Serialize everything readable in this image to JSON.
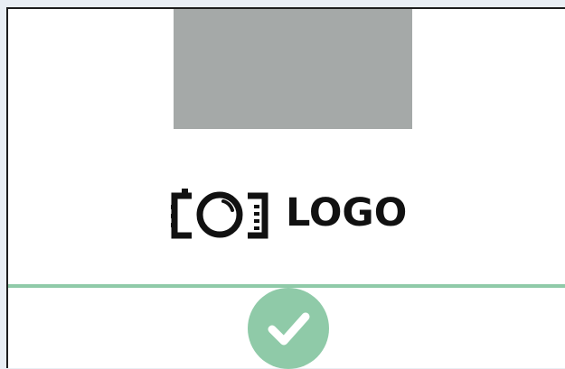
{
  "logo": {
    "text": "LOGO",
    "icon": "camera-icon"
  },
  "status": {
    "icon": "checkmark-icon",
    "color": "#8fcaa8"
  },
  "placeholder": {
    "color": "#a5a9a8"
  }
}
